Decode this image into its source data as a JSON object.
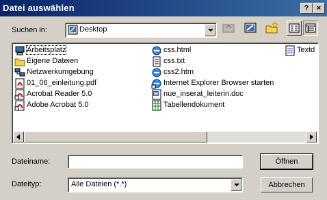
{
  "window": {
    "title": "Datei auswählen",
    "help_label": "?",
    "close_label": "×"
  },
  "toolbar": {
    "look_in_label": "Suchen in:",
    "look_in_value": "Desktop"
  },
  "files": {
    "col1": [
      "Arbeitsplatz",
      "Eigene Dateien",
      "Netzwerkumgebung",
      "01_06_einleitung.pdf",
      "Acrobat Reader 5.0",
      "Adobe Acrobat 5.0"
    ],
    "col2": [
      "css.html",
      "css.txt",
      "css2.htm",
      "Internet Explorer Browser starten",
      "nue_inserat_leiterin.doc",
      "Tabellendokument"
    ],
    "col3": [
      "Textd"
    ]
  },
  "form": {
    "filename_label": "Dateiname:",
    "filename_value": "",
    "filetype_label": "Dateityp:",
    "filetype_value": "Alle Dateien (*.*)",
    "open_label": "Öffnen",
    "cancel_label": "Abbrechen"
  }
}
